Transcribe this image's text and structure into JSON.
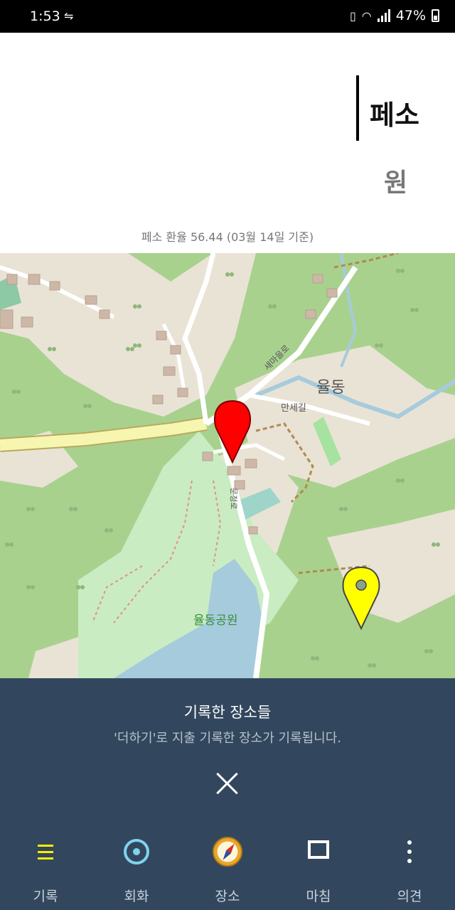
{
  "status_bar": {
    "time": "1:53",
    "battery": "47%",
    "usb_icon": "usb-icon"
  },
  "header": {
    "currency_main": "페소",
    "currency_sub": "원",
    "rate_note": "페소 환율 56.44 (03월 14일 기준)"
  },
  "map": {
    "labels": {
      "neighborhood": "율동",
      "road_1": "새마을로",
      "road_2": "만세길",
      "road_3": "문정로",
      "park": "율동공원"
    },
    "markers": [
      {
        "color": "#ff0000",
        "name": "red-map-pin"
      },
      {
        "color": "#ffff00",
        "name": "yellow-map-pin"
      }
    ]
  },
  "panel": {
    "title": "기록한 장소들",
    "subtitle": "'더하기'로 지출 기록한 장소가 기록됩니다."
  },
  "nav": {
    "items": [
      {
        "label": "기록",
        "icon": "list-icon",
        "active": true
      },
      {
        "label": "회화",
        "icon": "target-icon"
      },
      {
        "label": "장소",
        "icon": "compass-icon"
      },
      {
        "label": "마침",
        "icon": "square-icon"
      },
      {
        "label": "의견",
        "icon": "more-vertical-icon"
      }
    ]
  },
  "colors": {
    "panel_bg": "#32475e",
    "active_accent": "#ffeb00",
    "map_green": "#a9d18e"
  }
}
